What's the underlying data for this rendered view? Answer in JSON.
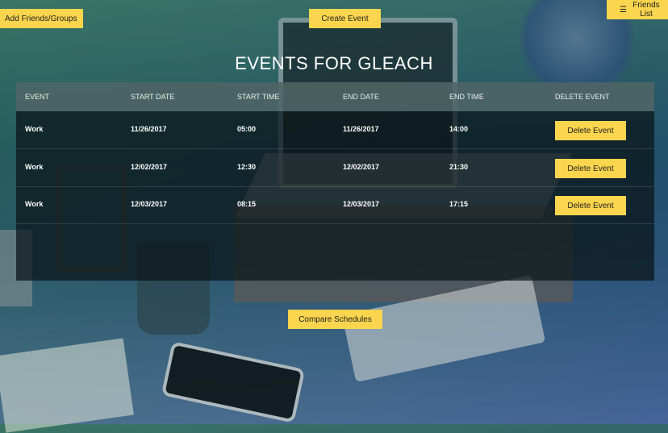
{
  "toolbar": {
    "add_friends_label": "Add Friends/Groups",
    "create_event_label": "Create Event",
    "friends_list_label": "Friends List",
    "friends_list_icon": "hamburger-icon"
  },
  "page_title": "EVENTS FOR GLEACH",
  "table": {
    "columns": [
      "EVENT",
      "START DATE",
      "START TIME",
      "END DATE",
      "END TIME",
      "DELETE EVENT"
    ],
    "rows": [
      {
        "event": "Work",
        "start_date": "11/26/2017",
        "start_time": "05:00",
        "end_date": "11/26/2017",
        "end_time": "14:00",
        "action": "Delete Event"
      },
      {
        "event": "Work",
        "start_date": "12/02/2017",
        "start_time": "12:30",
        "end_date": "12/02/2017",
        "end_time": "21:30",
        "action": "Delete Event"
      },
      {
        "event": "Work",
        "start_date": "12/03/2017",
        "start_time": "08:15",
        "end_date": "12/03/2017",
        "end_time": "17:15",
        "action": "Delete Event"
      }
    ]
  },
  "footer": {
    "compare_label": "Compare Schedules"
  },
  "colors": {
    "accent": "#fbd54d",
    "table_bg": "#0a1418",
    "header_bg": "#789696"
  }
}
